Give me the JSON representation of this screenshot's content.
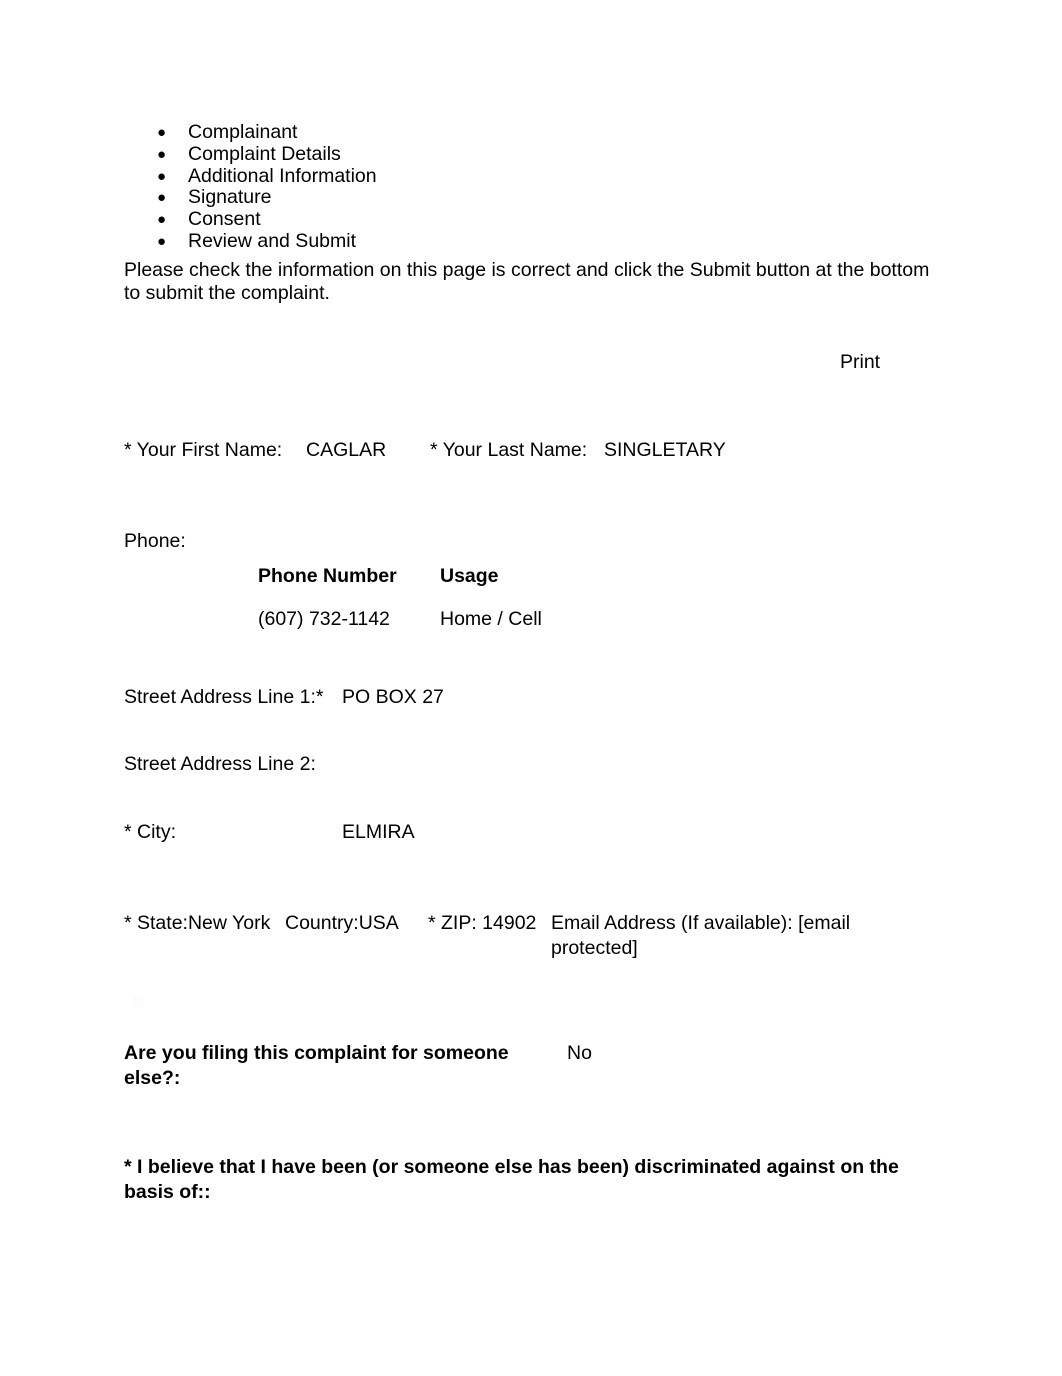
{
  "steps": {
    "bullet_glyph": "●",
    "items": [
      {
        "label": "Complainant"
      },
      {
        "label": "Complaint Details"
      },
      {
        "label": "Additional Information"
      },
      {
        "label": "Signature"
      },
      {
        "label": "Consent"
      },
      {
        "label": "Review and Submit"
      }
    ]
  },
  "instructions": {
    "text": "Please check the information on this page is correct and click the Submit button at the bottom to submit the complaint."
  },
  "actions": {
    "print_label": "Print"
  },
  "complainant": {
    "first_name_label": "* Your First Name:",
    "first_name_value": "CAGLAR",
    "last_name_label": "* Your Last Name:",
    "last_name_value": "SINGLETARY",
    "phone_section_label": "Phone:",
    "phone_table": {
      "headers": {
        "number": "Phone Number",
        "usage": "Usage"
      },
      "rows": [
        {
          "number": "(607) 732-1142",
          "usage": "Home / Cell"
        }
      ]
    },
    "street1_label": "Street Address Line 1:*",
    "street1_value": "PO BOX 27",
    "street2_label": "Street Address Line 2:",
    "street2_value": "",
    "city_label": "* City:",
    "city_value": "ELMIRA",
    "state_text": "* State:New York",
    "country_text": "Country:USA",
    "zip_text": "* ZIP: 14902",
    "email_label": "Email Address (If available):",
    "email_value": "[email protected]"
  },
  "filing_question": {
    "label": "Are you filing this complaint for someone else?:",
    "answer": "No"
  },
  "basis_statement": {
    "text": "* I believe that I have been (or someone else has been) discriminated against on the basis of::"
  }
}
